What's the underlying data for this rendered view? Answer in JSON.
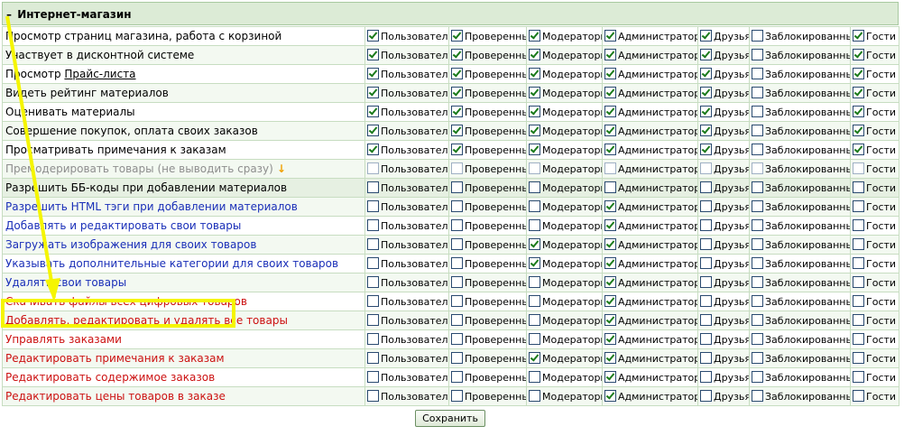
{
  "section": {
    "toggle": "–",
    "title": "Интернет-магазин"
  },
  "groups": [
    "Пользователи",
    "Проверенные",
    "Модераторы",
    "Администраторы",
    "Друзья",
    "Заблокированные",
    "Гости"
  ],
  "rows": [
    {
      "label": "Просмотр страниц магазина, работа с корзиной",
      "color": "black",
      "checks": [
        1,
        1,
        1,
        1,
        1,
        0,
        1
      ]
    },
    {
      "label": "Участвует в дисконтной системе",
      "color": "black",
      "checks": [
        1,
        1,
        1,
        1,
        1,
        0,
        1
      ]
    },
    {
      "label": "Просмотр ",
      "link": "Прайс-листа",
      "color": "black",
      "checks": [
        1,
        1,
        1,
        1,
        1,
        0,
        1
      ]
    },
    {
      "label": "Видеть рейтинг материалов",
      "color": "black",
      "checks": [
        1,
        1,
        1,
        1,
        1,
        0,
        1
      ]
    },
    {
      "label": "Оценивать материалы",
      "color": "black",
      "checks": [
        1,
        1,
        1,
        1,
        1,
        0,
        1
      ]
    },
    {
      "label": "Совершение покупок, оплата своих заказов",
      "color": "black",
      "checks": [
        1,
        1,
        1,
        1,
        1,
        0,
        1
      ]
    },
    {
      "label": "Просматривать примечания к заказам",
      "color": "black",
      "checks": [
        1,
        1,
        1,
        1,
        1,
        0,
        1
      ]
    },
    {
      "label": "Премодерировать товары (не выводить сразу)",
      "suffix": "↓",
      "color": "gray",
      "checks": [
        0,
        0,
        0,
        0,
        0,
        0,
        0
      ]
    },
    {
      "label": "Разрешить ББ-коды при добавлении материалов",
      "color": "black",
      "checks": [
        0,
        0,
        0,
        0,
        0,
        0,
        0
      ]
    },
    {
      "label": "Разрешить HTML тэги при добавлении материалов",
      "color": "blue",
      "checks": [
        0,
        0,
        0,
        1,
        0,
        0,
        0
      ]
    },
    {
      "label": "Добавлять и редактировать свои товары",
      "color": "blue",
      "checks": [
        0,
        0,
        0,
        1,
        0,
        0,
        0
      ]
    },
    {
      "label": "Загружать изображения для своих товаров",
      "color": "blue",
      "checks": [
        0,
        0,
        1,
        1,
        0,
        0,
        0
      ]
    },
    {
      "label": "Указывать дополнительные категории для своих товаров",
      "color": "blue",
      "checks": [
        0,
        0,
        1,
        1,
        0,
        0,
        0
      ]
    },
    {
      "label": "Удалять свои товары",
      "color": "blue",
      "checks": [
        0,
        0,
        0,
        1,
        0,
        0,
        0
      ]
    },
    {
      "label": "Скачивать файлы всех цифровых товаров",
      "color": "red",
      "checks": [
        0,
        0,
        0,
        1,
        0,
        0,
        0
      ]
    },
    {
      "label": "Добавлять, редактировать и удалять все товары",
      "color": "red",
      "checks": [
        0,
        0,
        0,
        1,
        0,
        0,
        0
      ]
    },
    {
      "label": "Управлять заказами",
      "color": "red",
      "checks": [
        0,
        0,
        0,
        1,
        0,
        0,
        0
      ]
    },
    {
      "label": "Редактировать примечания к заказам",
      "color": "red",
      "checks": [
        0,
        0,
        1,
        1,
        0,
        0,
        0
      ]
    },
    {
      "label": "Редактировать содержимое заказов",
      "color": "red",
      "checks": [
        0,
        0,
        0,
        1,
        0,
        0,
        0
      ]
    },
    {
      "label": "Редактировать цены товаров в заказе",
      "color": "red",
      "checks": [
        0,
        0,
        0,
        1,
        0,
        0,
        0
      ]
    }
  ],
  "save_label": "Сохранить",
  "colors": {
    "accent_highlight": "#f5f500",
    "arrow": "#f5f500",
    "header_bg": "#dcebd6"
  }
}
